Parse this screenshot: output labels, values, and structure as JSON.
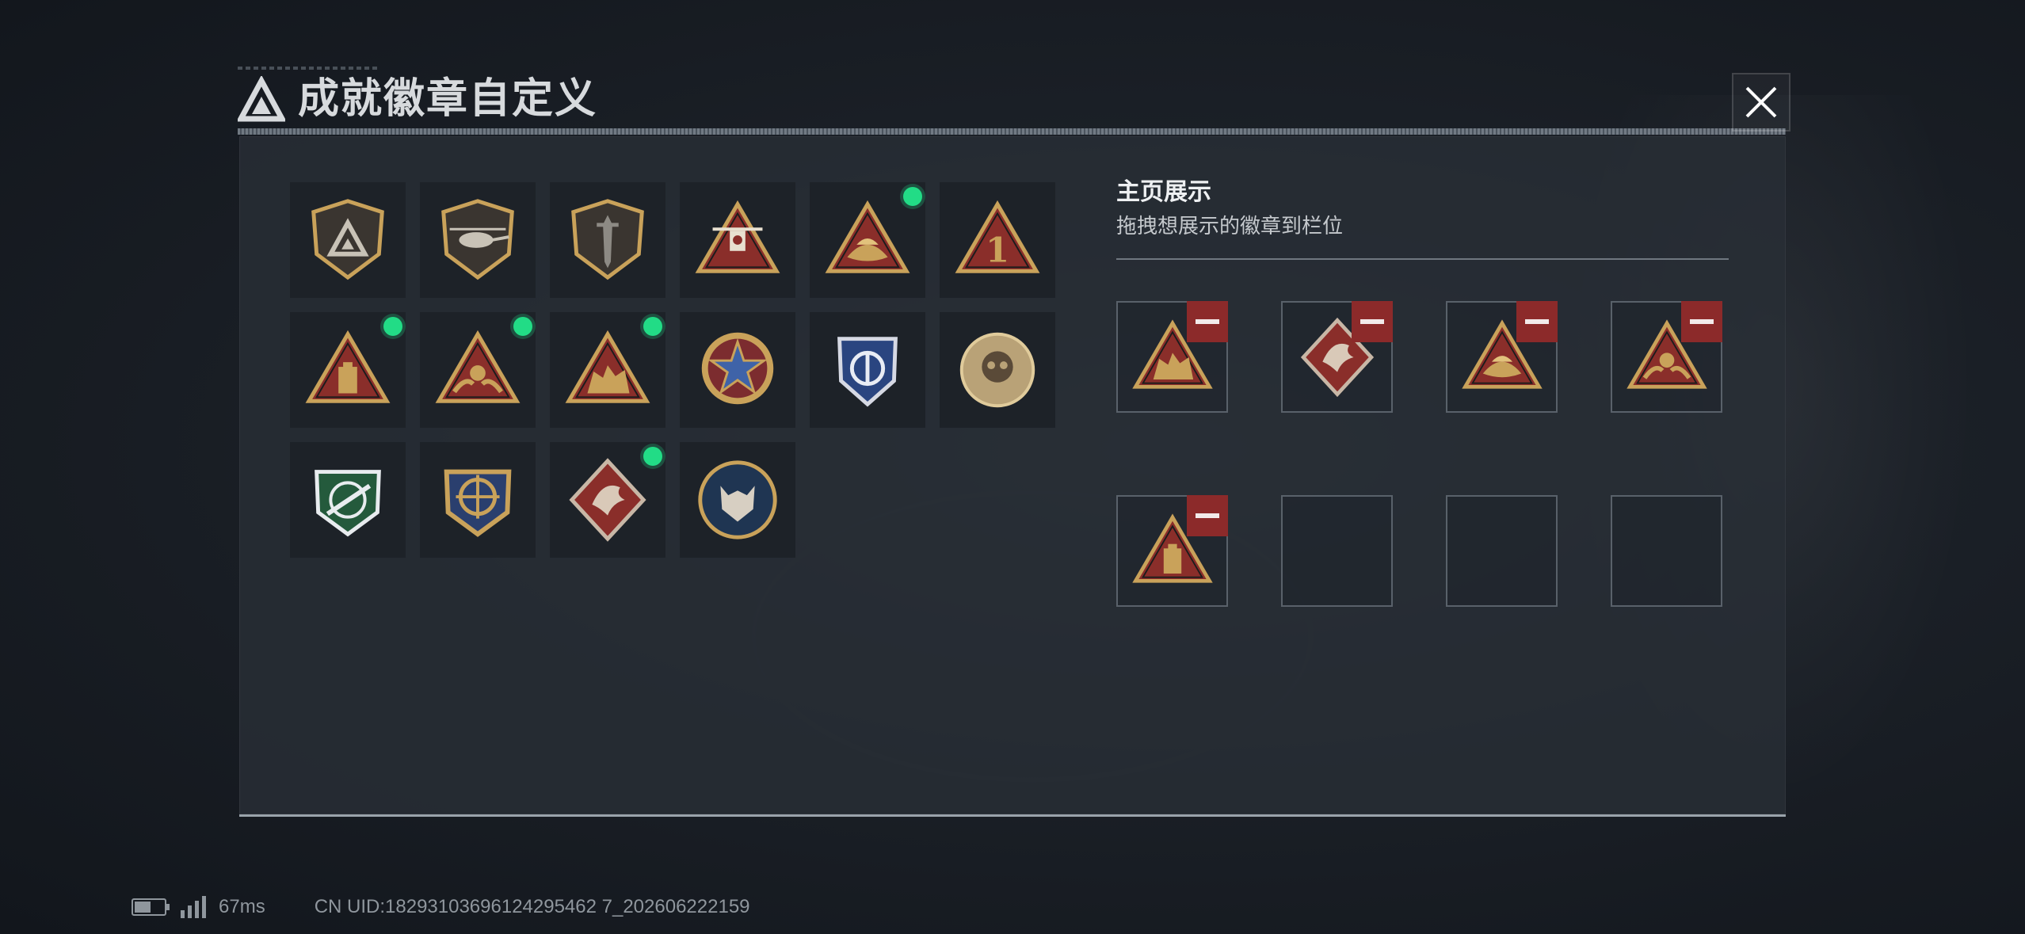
{
  "header": {
    "title": "成就徽章自定义",
    "logo_icon": "triangle-a-logo-icon",
    "close_icon": "close-x-icon"
  },
  "badge_library": [
    {
      "icon": "shield-triangle-badge-icon",
      "new": false
    },
    {
      "icon": "helicopter-shield-badge-icon",
      "new": false
    },
    {
      "icon": "dagger-shield-badge-icon",
      "new": false
    },
    {
      "icon": "robot-triangle-badge-icon",
      "new": false
    },
    {
      "icon": "wings-triangle-badge-icon",
      "new": true
    },
    {
      "icon": "number-one-triangle-badge-icon",
      "new": false
    },
    {
      "icon": "tower-triangle-badge-icon",
      "new": true
    },
    {
      "icon": "hands-triangle-badge-icon",
      "new": true
    },
    {
      "icon": "beast-triangle-badge-icon",
      "new": true
    },
    {
      "icon": "star-medal-badge-icon",
      "new": false
    },
    {
      "icon": "blue-eagle-badge-icon",
      "new": false
    },
    {
      "icon": "gold-skull-badge-icon",
      "new": false
    },
    {
      "icon": "green-rifle-badge-icon",
      "new": false
    },
    {
      "icon": "crosshair-wreath-badge-icon",
      "new": false
    },
    {
      "icon": "dragon-diamond-badge-icon",
      "new": true
    },
    {
      "icon": "wolf-medal-badge-icon",
      "new": false
    }
  ],
  "showcase": {
    "title": "主页展示",
    "subtitle": "拖拽想展示的徽章到栏位",
    "slots": [
      {
        "badge": "beast-triangle-badge-icon",
        "filled": true
      },
      {
        "badge": "dragon-diamond-badge-icon",
        "filled": true
      },
      {
        "badge": "wings-triangle-badge-icon",
        "filled": true
      },
      {
        "badge": "hands-triangle-badge-icon",
        "filled": true
      },
      {
        "badge": "tower-triangle-badge-icon",
        "filled": true
      },
      {
        "badge": "",
        "filled": false
      },
      {
        "badge": "",
        "filled": false
      },
      {
        "badge": "",
        "filled": false
      }
    ]
  },
  "status": {
    "ping": "67ms",
    "uid": "CN UID:18293103696124295462 7_202606222159"
  },
  "colors": {
    "accent_new": "#22dc86",
    "remove": "#8c2a2a",
    "gold": "#c9a25a",
    "badge_red": "#8a2e2a"
  }
}
